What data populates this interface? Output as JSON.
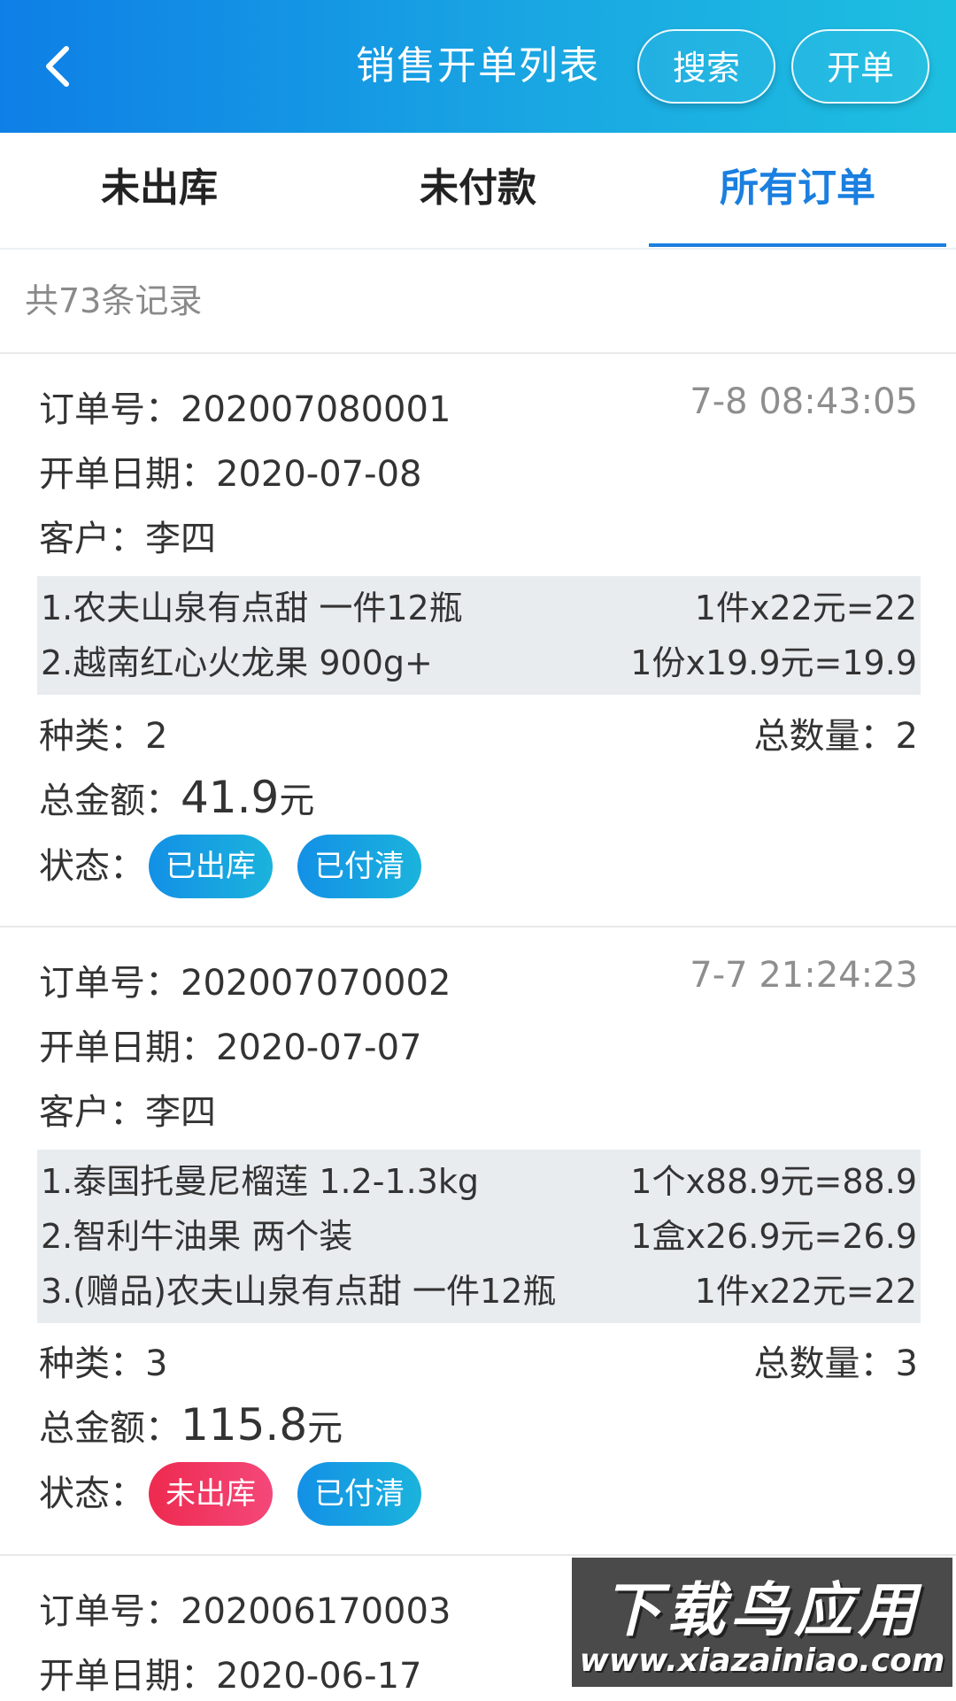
{
  "header": {
    "title": "销售开单列表",
    "search_label": "搜索",
    "open_label": "开单"
  },
  "tabs": [
    {
      "label": "未出库"
    },
    {
      "label": "未付款"
    },
    {
      "label": "所有订单",
      "active": true
    }
  ],
  "record_count": "共73条记录",
  "labels": {
    "order_no": "订单号：",
    "open_date": "开单日期：",
    "customer": "客户：",
    "kinds": "种类：",
    "total_qty": "总数量：",
    "total_amount": "总金额：",
    "yuan": "元",
    "status": "状态："
  },
  "orders": [
    {
      "order_no": "202007080001",
      "time": "7-8 08:43:05",
      "open_date": "2020-07-08",
      "customer": "李四",
      "items": [
        {
          "name": "1.农夫山泉有点甜 一件12瓶",
          "price": "1件x22元=22"
        },
        {
          "name": "2.越南红心火龙果 900g+",
          "price": "1份x19.9元=19.9"
        }
      ],
      "kinds": "2",
      "total_qty": "2",
      "total_amount": "41.9",
      "statuses": [
        {
          "label": "已出库",
          "color": "#1a9fe0"
        },
        {
          "label": "已付清",
          "color": "#1a9fe0"
        }
      ]
    },
    {
      "order_no": "202007070002",
      "time": "7-7 21:24:23",
      "open_date": "2020-07-07",
      "customer": "李四",
      "items": [
        {
          "name": "1.泰国托曼尼榴莲 1.2-1.3kg",
          "price": "1个x88.9元=88.9"
        },
        {
          "name": "2.智利牛油果 两个装",
          "price": "1盒x26.9元=26.9"
        },
        {
          "name": "3.(赠品)农夫山泉有点甜 一件12瓶",
          "price": "1件x22元=22"
        }
      ],
      "kinds": "3",
      "total_qty": "3",
      "total_amount": "115.8",
      "statuses": [
        {
          "label": "未出库",
          "color": "#f0325f"
        },
        {
          "label": "已付清",
          "color": "#1a9fe0"
        }
      ]
    },
    {
      "order_no": "202006170003",
      "open_date": "2020-06-17"
    }
  ],
  "watermark": {
    "text": "下载鸟应用",
    "url": "www.xiazainiao.com"
  }
}
